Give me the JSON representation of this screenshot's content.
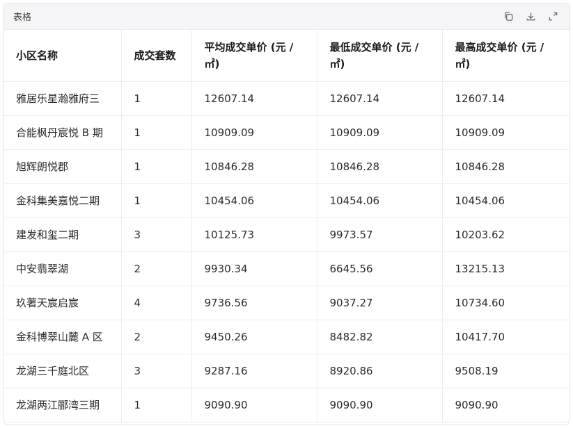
{
  "header": {
    "title": "表格",
    "icons": [
      "copy-icon",
      "download-icon",
      "expand-icon"
    ]
  },
  "table": {
    "columns": [
      "小区名称",
      "成交套数",
      "平均成交单价 (元 / ㎡)",
      "最低成交单价 (元 / ㎡)",
      "最高成交单价 (元 / ㎡)"
    ],
    "rows": [
      [
        "雅居乐星瀚雅府三",
        "1",
        "12607.14",
        "12607.14",
        "12607.14"
      ],
      [
        "合能枫丹宸悦 B 期",
        "1",
        "10909.09",
        "10909.09",
        "10909.09"
      ],
      [
        "旭辉朗悦郡",
        "1",
        "10846.28",
        "10846.28",
        "10846.28"
      ],
      [
        "金科集美嘉悦二期",
        "1",
        "10454.06",
        "10454.06",
        "10454.06"
      ],
      [
        "建发和玺二期",
        "3",
        "10125.73",
        "9973.57",
        "10203.62"
      ],
      [
        "中安翡翠湖",
        "2",
        "9930.34",
        "6645.56",
        "13215.13"
      ],
      [
        "玖著天宸启宸",
        "4",
        "9736.56",
        "9037.27",
        "10734.60"
      ],
      [
        "金科博翠山麓 A 区",
        "2",
        "9450.26",
        "8482.82",
        "10417.70"
      ],
      [
        "龙湖三千庭北区",
        "3",
        "9287.16",
        "8920.86",
        "9508.19"
      ],
      [
        "龙湖两江郦湾三期",
        "1",
        "9090.90",
        "9090.90",
        "9090.90"
      ]
    ]
  }
}
